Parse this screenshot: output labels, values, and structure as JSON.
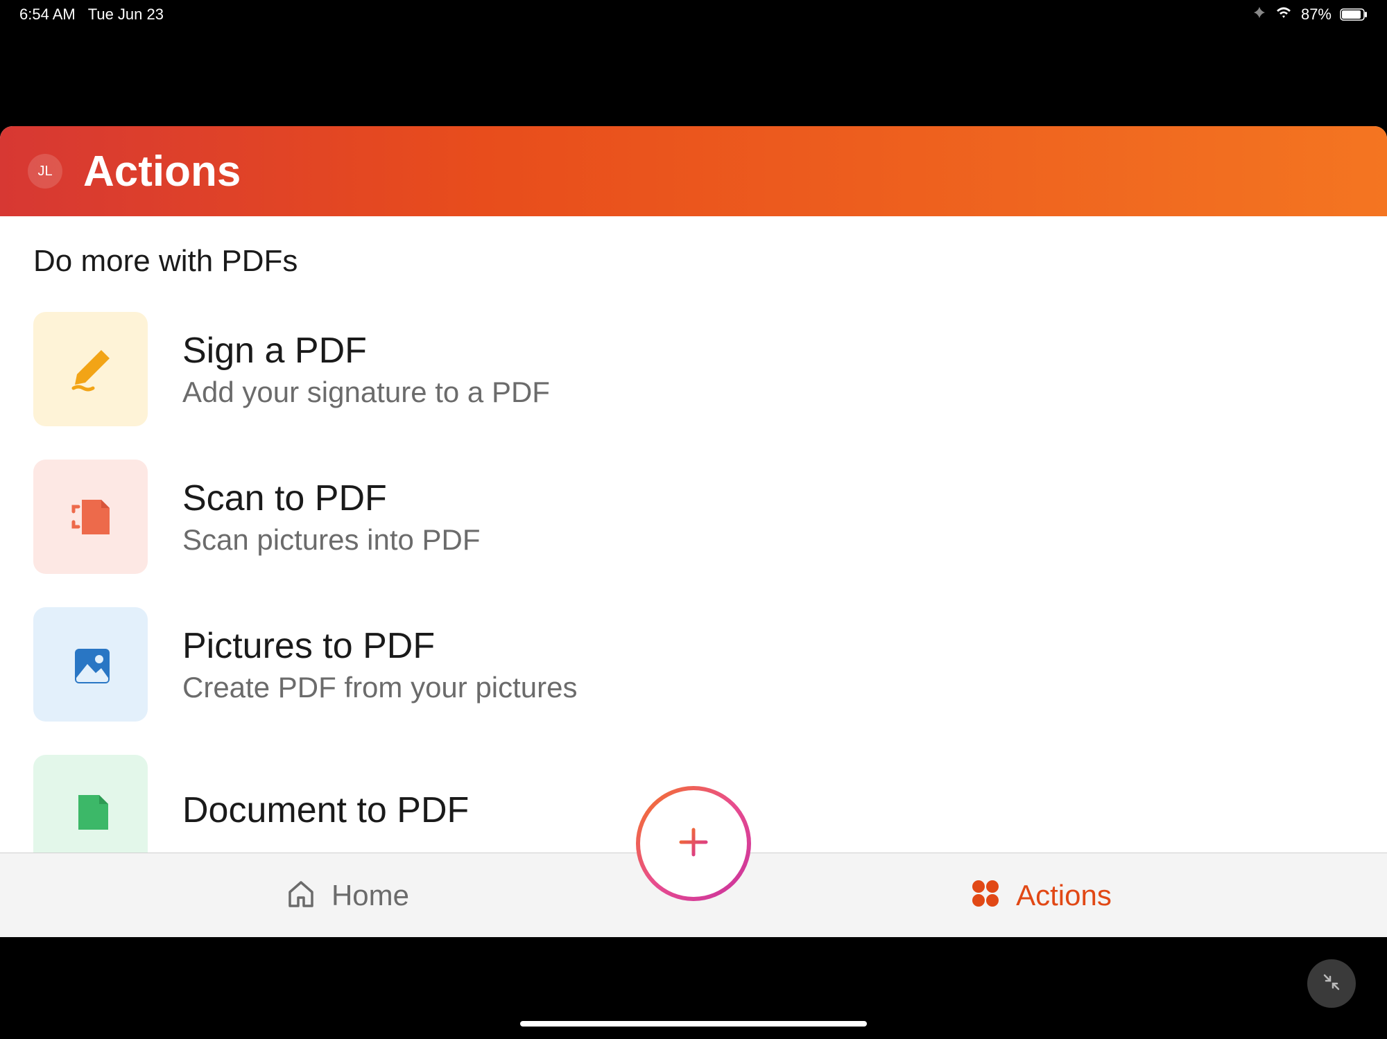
{
  "statusBar": {
    "time": "6:54 AM",
    "date": "Tue Jun 23",
    "battery": "87%"
  },
  "header": {
    "avatar": "JL",
    "title": "Actions"
  },
  "content": {
    "sectionTitle": "Do more with PDFs",
    "actions": [
      {
        "title": "Sign a PDF",
        "subtitle": "Add your signature to a PDF"
      },
      {
        "title": "Scan to PDF",
        "subtitle": "Scan pictures into PDF"
      },
      {
        "title": "Pictures to PDF",
        "subtitle": "Create PDF from your pictures"
      },
      {
        "title": "Document to PDF",
        "subtitle": ""
      }
    ]
  },
  "bottomNav": {
    "home": "Home",
    "actions": "Actions"
  }
}
